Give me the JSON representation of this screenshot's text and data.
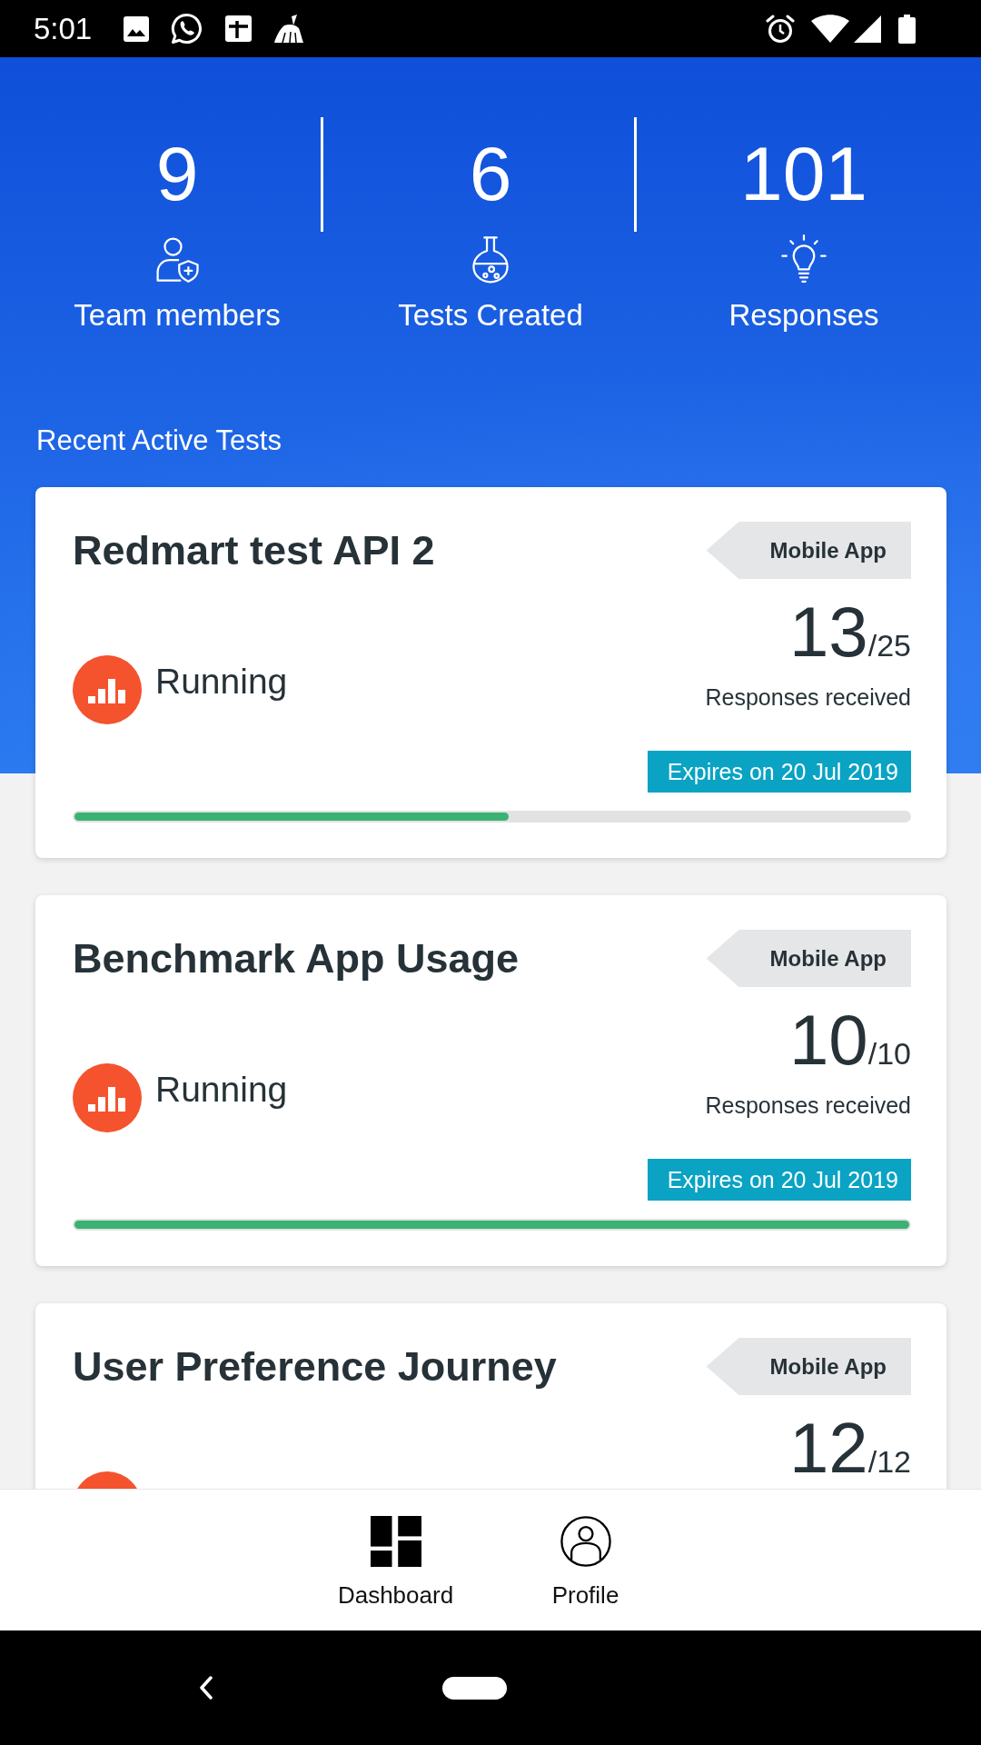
{
  "status_bar": {
    "time": "5:01"
  },
  "stats": [
    {
      "kind": "team",
      "value": "9",
      "label": "Team members"
    },
    {
      "kind": "tests",
      "value": "6",
      "label": "Tests Created"
    },
    {
      "kind": "responses",
      "value": "101",
      "label": "Responses"
    }
  ],
  "section_title": "Recent Active Tests",
  "tests": [
    {
      "title": "Redmart test API 2",
      "tag": "Mobile App",
      "count": "13",
      "total": "/25",
      "count_label": "Responses received",
      "status": {
        "kind": "running",
        "label": "Running"
      },
      "expiry": "Expires on 20 Jul 2019",
      "level": 0.52
    },
    {
      "title": "Benchmark App Usage",
      "tag": "Mobile App",
      "count": "10",
      "total": "/10",
      "count_label": "Responses received",
      "status": {
        "kind": "running",
        "label": "Running"
      },
      "expiry": "Expires on 20 Jul 2019",
      "level": 1
    },
    {
      "title": "User Preference Journey",
      "tag": "Mobile App",
      "count": "12",
      "total": "/12",
      "status": {
        "kind": "running"
      }
    }
  ],
  "bottom_nav": [
    {
      "kind": "dashboard",
      "label": "Dashboard"
    },
    {
      "kind": "profile",
      "label": "Profile"
    }
  ]
}
